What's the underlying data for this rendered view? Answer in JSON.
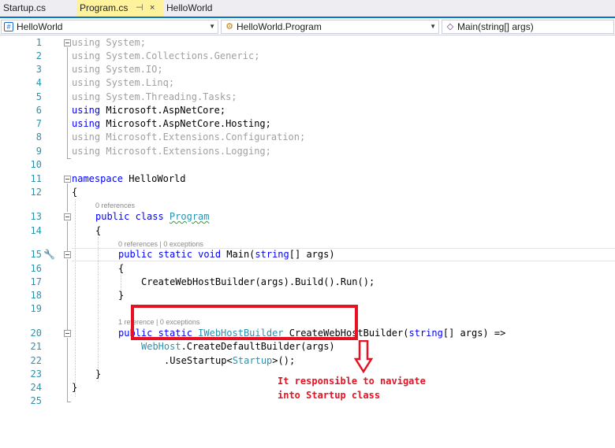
{
  "tabs": [
    {
      "label": "Startup.cs"
    },
    {
      "label": "Program.cs",
      "pin": "⊣",
      "close": "×"
    },
    {
      "label": "HelloWorld"
    }
  ],
  "navbar": {
    "project": "HelloWorld",
    "type": "HelloWorld.Program",
    "member": "Main(string[] args)"
  },
  "line_numbers": [
    "1",
    "2",
    "3",
    "4",
    "5",
    "6",
    "7",
    "8",
    "9",
    "10",
    "11",
    "12",
    "13",
    "14",
    "15",
    "16",
    "17",
    "18",
    "19",
    "20",
    "21",
    "22",
    "23",
    "24",
    "25"
  ],
  "code": {
    "l1": {
      "kw": "using",
      "ns": " System;"
    },
    "l2": {
      "kw": "using",
      "ns": " System.Collections.Generic;"
    },
    "l3": {
      "kw": "using",
      "ns": " System.IO;"
    },
    "l4": {
      "kw": "using",
      "ns": " System.Linq;"
    },
    "l5": {
      "kw": "using",
      "ns": " System.Threading.Tasks;"
    },
    "l6": {
      "kw": "using",
      "ns": " Microsoft.AspNetCore;"
    },
    "l7": {
      "kw": "using",
      "ns": " Microsoft.AspNetCore.Hosting;"
    },
    "l8": {
      "kw": "using",
      "ns": " Microsoft.Extensions.Configuration;"
    },
    "l9": {
      "kw": "using",
      "ns": " Microsoft.Extensions.Logging;"
    },
    "l11": {
      "kw": "namespace",
      "name": " HelloWorld"
    },
    "l12": "{",
    "l13": {
      "kw": "public class ",
      "name": "Program"
    },
    "l14": "{",
    "l15": {
      "kw": "public static void ",
      "name": "Main(",
      "kw2": "string",
      "rest": "[] args)"
    },
    "l16": "{",
    "l17": "CreateWebHostBuilder(args).Build().Run();",
    "l18": "}",
    "l20": {
      "kw": "public static ",
      "type": "IWebHostBuilder",
      "name": " CreateWebHostBuilder(",
      "kw2": "string",
      "rest": "[] args) =>"
    },
    "l21": {
      "type": "WebHost",
      "rest": ".CreateDefaultBuilder(args)"
    },
    "l22": {
      "pre": ".UseStartup<",
      "type": "Startup",
      "rest": ">();"
    },
    "l23": "}",
    "l24": "}"
  },
  "codelens": {
    "program": "0 references",
    "main": "0 references | 0 exceptions",
    "builder": "1 reference | 0 exceptions"
  },
  "annotation": {
    "line1": "It responsible to navigate",
    "line2": "into Startup class"
  },
  "colors": {
    "keyword": "#0000ff",
    "type": "#2b91af",
    "annotation": "#e81123",
    "active_tab": "#fff29d"
  }
}
